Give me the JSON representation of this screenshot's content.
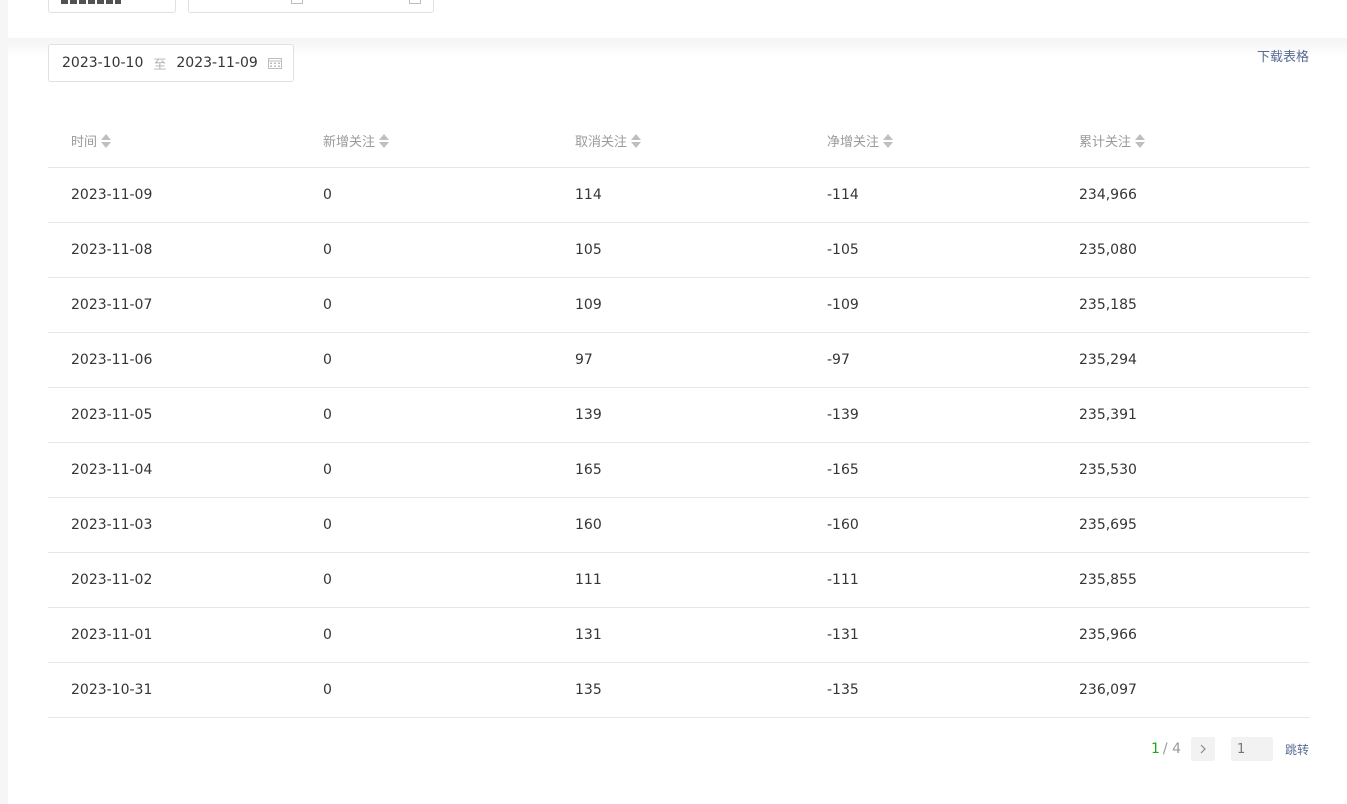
{
  "filters": {
    "date_start": "2023-10-10",
    "date_separator": "至",
    "date_end": "2023-11-09",
    "download_label": "下载表格"
  },
  "table": {
    "headers": [
      "时间",
      "新增关注",
      "取消关注",
      "净增关注",
      "累计关注"
    ],
    "rows": [
      [
        "2023-11-09",
        "0",
        "114",
        "-114",
        "234,966"
      ],
      [
        "2023-11-08",
        "0",
        "105",
        "-105",
        "235,080"
      ],
      [
        "2023-11-07",
        "0",
        "109",
        "-109",
        "235,185"
      ],
      [
        "2023-11-06",
        "0",
        "97",
        "-97",
        "235,294"
      ],
      [
        "2023-11-05",
        "0",
        "139",
        "-139",
        "235,391"
      ],
      [
        "2023-11-04",
        "0",
        "165",
        "-165",
        "235,530"
      ],
      [
        "2023-11-03",
        "0",
        "160",
        "-160",
        "235,695"
      ],
      [
        "2023-11-02",
        "0",
        "111",
        "-111",
        "235,855"
      ],
      [
        "2023-11-01",
        "0",
        "131",
        "-131",
        "235,966"
      ],
      [
        "2023-10-31",
        "0",
        "135",
        "-135",
        "236,097"
      ]
    ]
  },
  "pagination": {
    "current": "1",
    "total": "/ 4",
    "input_placeholder": "1",
    "jump_label": "跳转"
  },
  "colors": {
    "accent_green": "#1aad19",
    "link_blue": "#576b95"
  }
}
